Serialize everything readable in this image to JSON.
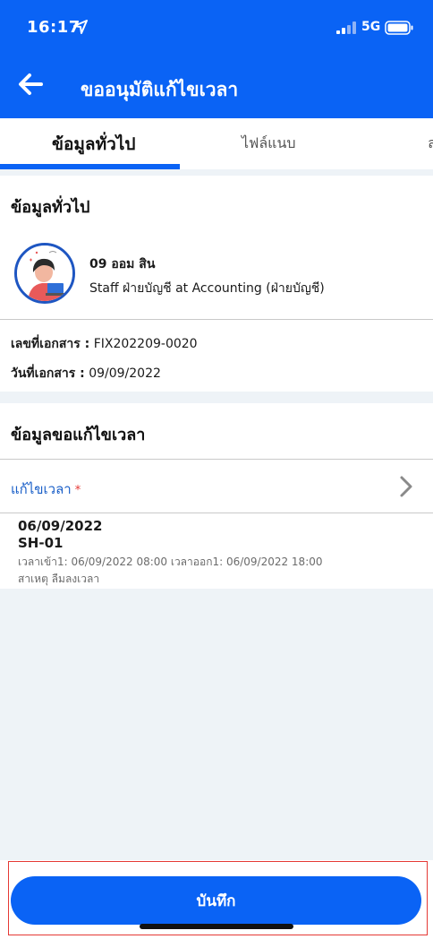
{
  "status_bar": {
    "time": "16:17",
    "network": "5G"
  },
  "header": {
    "title": "ขออนุมัติแก้ไขเวลา"
  },
  "tabs": [
    {
      "label": "ข้อมูลทั่วไป"
    },
    {
      "label": "ไฟล์แนบ"
    },
    {
      "label": "ล"
    }
  ],
  "general": {
    "section_title": "ข้อมูลทั่วไป",
    "employee_name": "09 ออม สิน",
    "employee_role": "Staff ฝ่ายบัญชี at Accounting (ฝ่ายบัญชี)",
    "doc_no_label": "เลขที่เอกสาร :",
    "doc_no": "FIX202209-0020",
    "doc_date_label": "วันที่เอกสาร :",
    "doc_date": "09/09/2022"
  },
  "correction": {
    "section_title": "ข้อมูลขอแก้ไขเวลา",
    "field_label": "แก้ไขเวลา",
    "required_mark": "*",
    "entry": {
      "date": "06/09/2022",
      "shift": "SH-01",
      "times": "เวลาเข้า1: 06/09/2022 08:00 เวลาออก1: 06/09/2022 18:00",
      "reason": "สาเหตุ ลืมลงเวลา"
    }
  },
  "footer": {
    "save_label": "บันทึก"
  },
  "colors": {
    "primary": "#0a63f5",
    "background": "#eef3f7",
    "link": "#1a5fc8",
    "required": "#e53935"
  }
}
